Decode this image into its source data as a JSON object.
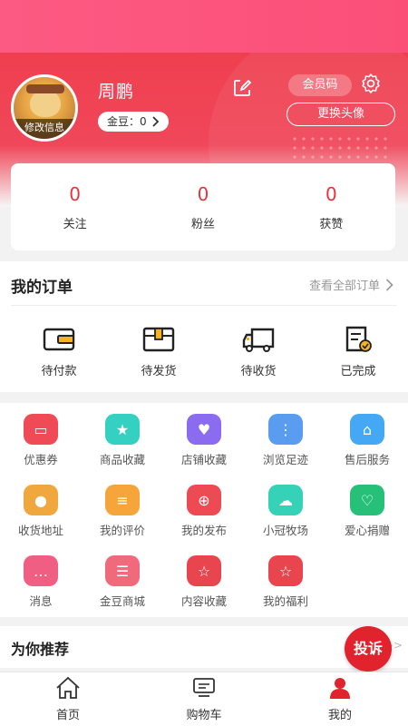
{
  "profile": {
    "name": "周鹏",
    "avatar_edit_label": "修改信息",
    "bean_label": "金豆：",
    "bean_value": "0",
    "member_code_label": "会员码",
    "change_avatar_label": "更换头像"
  },
  "stats": [
    {
      "value": "0",
      "label": "关注"
    },
    {
      "value": "0",
      "label": "粉丝"
    },
    {
      "value": "0",
      "label": "获赞"
    }
  ],
  "orders": {
    "title": "我的订单",
    "view_all": "查看全部订单",
    "items": [
      {
        "label": "待付款",
        "icon": "wallet-icon"
      },
      {
        "label": "待发货",
        "icon": "box-icon"
      },
      {
        "label": "待收货",
        "icon": "truck-icon"
      },
      {
        "label": "已完成",
        "icon": "completed-icon"
      }
    ]
  },
  "services": [
    {
      "label": "优惠券",
      "icon": "coupon-icon",
      "color": "#ef4a56"
    },
    {
      "label": "商品收藏",
      "icon": "star-icon",
      "color": "#34d1c2"
    },
    {
      "label": "店铺收藏",
      "icon": "heart-icon",
      "color": "#8b6cf0"
    },
    {
      "label": "浏览足迹",
      "icon": "footprint-icon",
      "color": "#5a9cf0"
    },
    {
      "label": "售后服务",
      "icon": "home-service-icon",
      "color": "#45a8f5"
    },
    {
      "label": "收货地址",
      "icon": "location-icon",
      "color": "#f0a83e"
    },
    {
      "label": "我的评价",
      "icon": "comment-icon",
      "color": "#f5a53a"
    },
    {
      "label": "我的发布",
      "icon": "publish-icon",
      "color": "#ee4a53"
    },
    {
      "label": "小冠牧场",
      "icon": "sheep-icon",
      "color": "#35d2b8"
    },
    {
      "label": "爱心捐赠",
      "icon": "donate-icon",
      "color": "#27c079"
    },
    {
      "label": "消息",
      "icon": "message-icon",
      "color": "#f05e84"
    },
    {
      "label": "金豆商城",
      "icon": "coins-icon",
      "color": "#f06a7b"
    },
    {
      "label": "内容收藏",
      "icon": "content-fav-icon",
      "color": "#e8454f"
    },
    {
      "label": "我的福利",
      "icon": "welfare-icon",
      "color": "#e8454f"
    }
  ],
  "recommend": {
    "title": "为你推荐",
    "more": ">>",
    "complaint_label": "投诉"
  },
  "tabbar": [
    {
      "label": "首页",
      "icon": "home-icon"
    },
    {
      "label": "购物车",
      "icon": "cart-icon"
    },
    {
      "label": "我的",
      "icon": "profile-icon"
    }
  ],
  "colors": {
    "brand": "#e8333d",
    "header": "#ef3f4f"
  }
}
